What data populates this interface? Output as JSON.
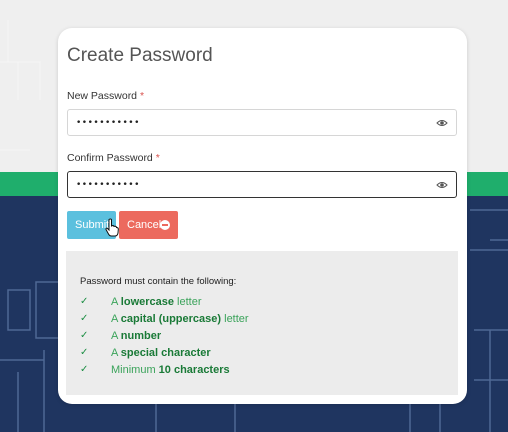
{
  "form": {
    "title": "Create Password",
    "new_password": {
      "label": "New Password",
      "required": "*",
      "value": "•••••••••••"
    },
    "confirm_password": {
      "label": "Confirm Password",
      "required": "*",
      "value": "•••••••••••"
    }
  },
  "buttons": {
    "submit_label": "Submit",
    "cancel_label": "Cancel"
  },
  "requirements": {
    "title": "Password must contain the following:",
    "check_symbol": "✓",
    "items": [
      {
        "prefix": "A ",
        "bold": "lowercase",
        "suffix": " letter"
      },
      {
        "prefix": "A ",
        "bold": "capital (uppercase)",
        "suffix": " letter"
      },
      {
        "prefix": "A ",
        "bold": "number",
        "suffix": ""
      },
      {
        "prefix": "A ",
        "bold": "special character",
        "suffix": ""
      },
      {
        "prefix": "Minimum ",
        "bold": "10 characters",
        "suffix": ""
      }
    ]
  },
  "colors": {
    "accent_submit": "#5bc0de",
    "accent_cancel": "#ec6a5e",
    "stripe": "#1fae6c",
    "navy": "#1f3560",
    "valid_green": "#1a7a37"
  },
  "icons": {
    "field_toggle": "eye-icon",
    "cancel": "minus-circle-icon",
    "cursor": "hand-pointer-icon"
  }
}
